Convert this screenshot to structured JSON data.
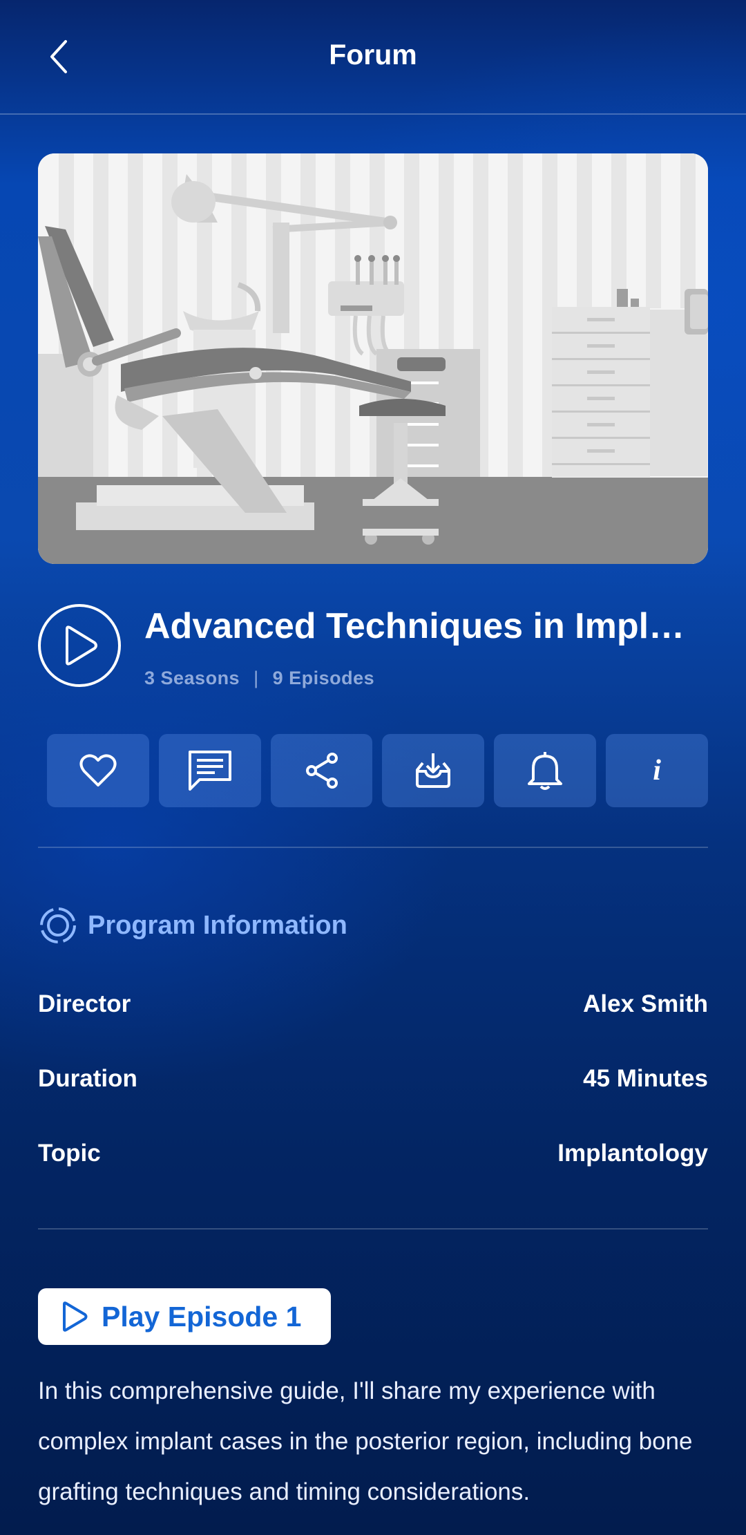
{
  "header": {
    "title": "Forum",
    "back_icon": "chevron-left-icon"
  },
  "hero": {
    "image": "dental-clinic-illustration"
  },
  "program": {
    "title": "Advanced Techniques in Implantology",
    "seasons": "3 Seasons",
    "separator": "|",
    "episodes": "9 Episodes"
  },
  "actions": [
    {
      "name": "like",
      "icon": "heart-icon"
    },
    {
      "name": "comment",
      "icon": "comment-icon"
    },
    {
      "name": "share",
      "icon": "share-icon"
    },
    {
      "name": "download",
      "icon": "download-icon"
    },
    {
      "name": "notify",
      "icon": "bell-icon"
    },
    {
      "name": "info",
      "icon": "info-icon",
      "label": "i"
    }
  ],
  "info": {
    "heading": "Program Information",
    "rows": [
      {
        "label": "Director",
        "value": "Alex Smith"
      },
      {
        "label": "Duration",
        "value": "45 Minutes"
      },
      {
        "label": "Topic",
        "value": "Implantology"
      }
    ]
  },
  "play_button": {
    "label": "Play Episode 1"
  },
  "description": "In this comprehensive guide, I'll share my experience with complex implant cases in the posterior region, including bone grafting techniques and timing considerations.",
  "colors": {
    "accent": "#8fb8ff",
    "button_text": "#1366d6",
    "background": "#0647b3"
  }
}
